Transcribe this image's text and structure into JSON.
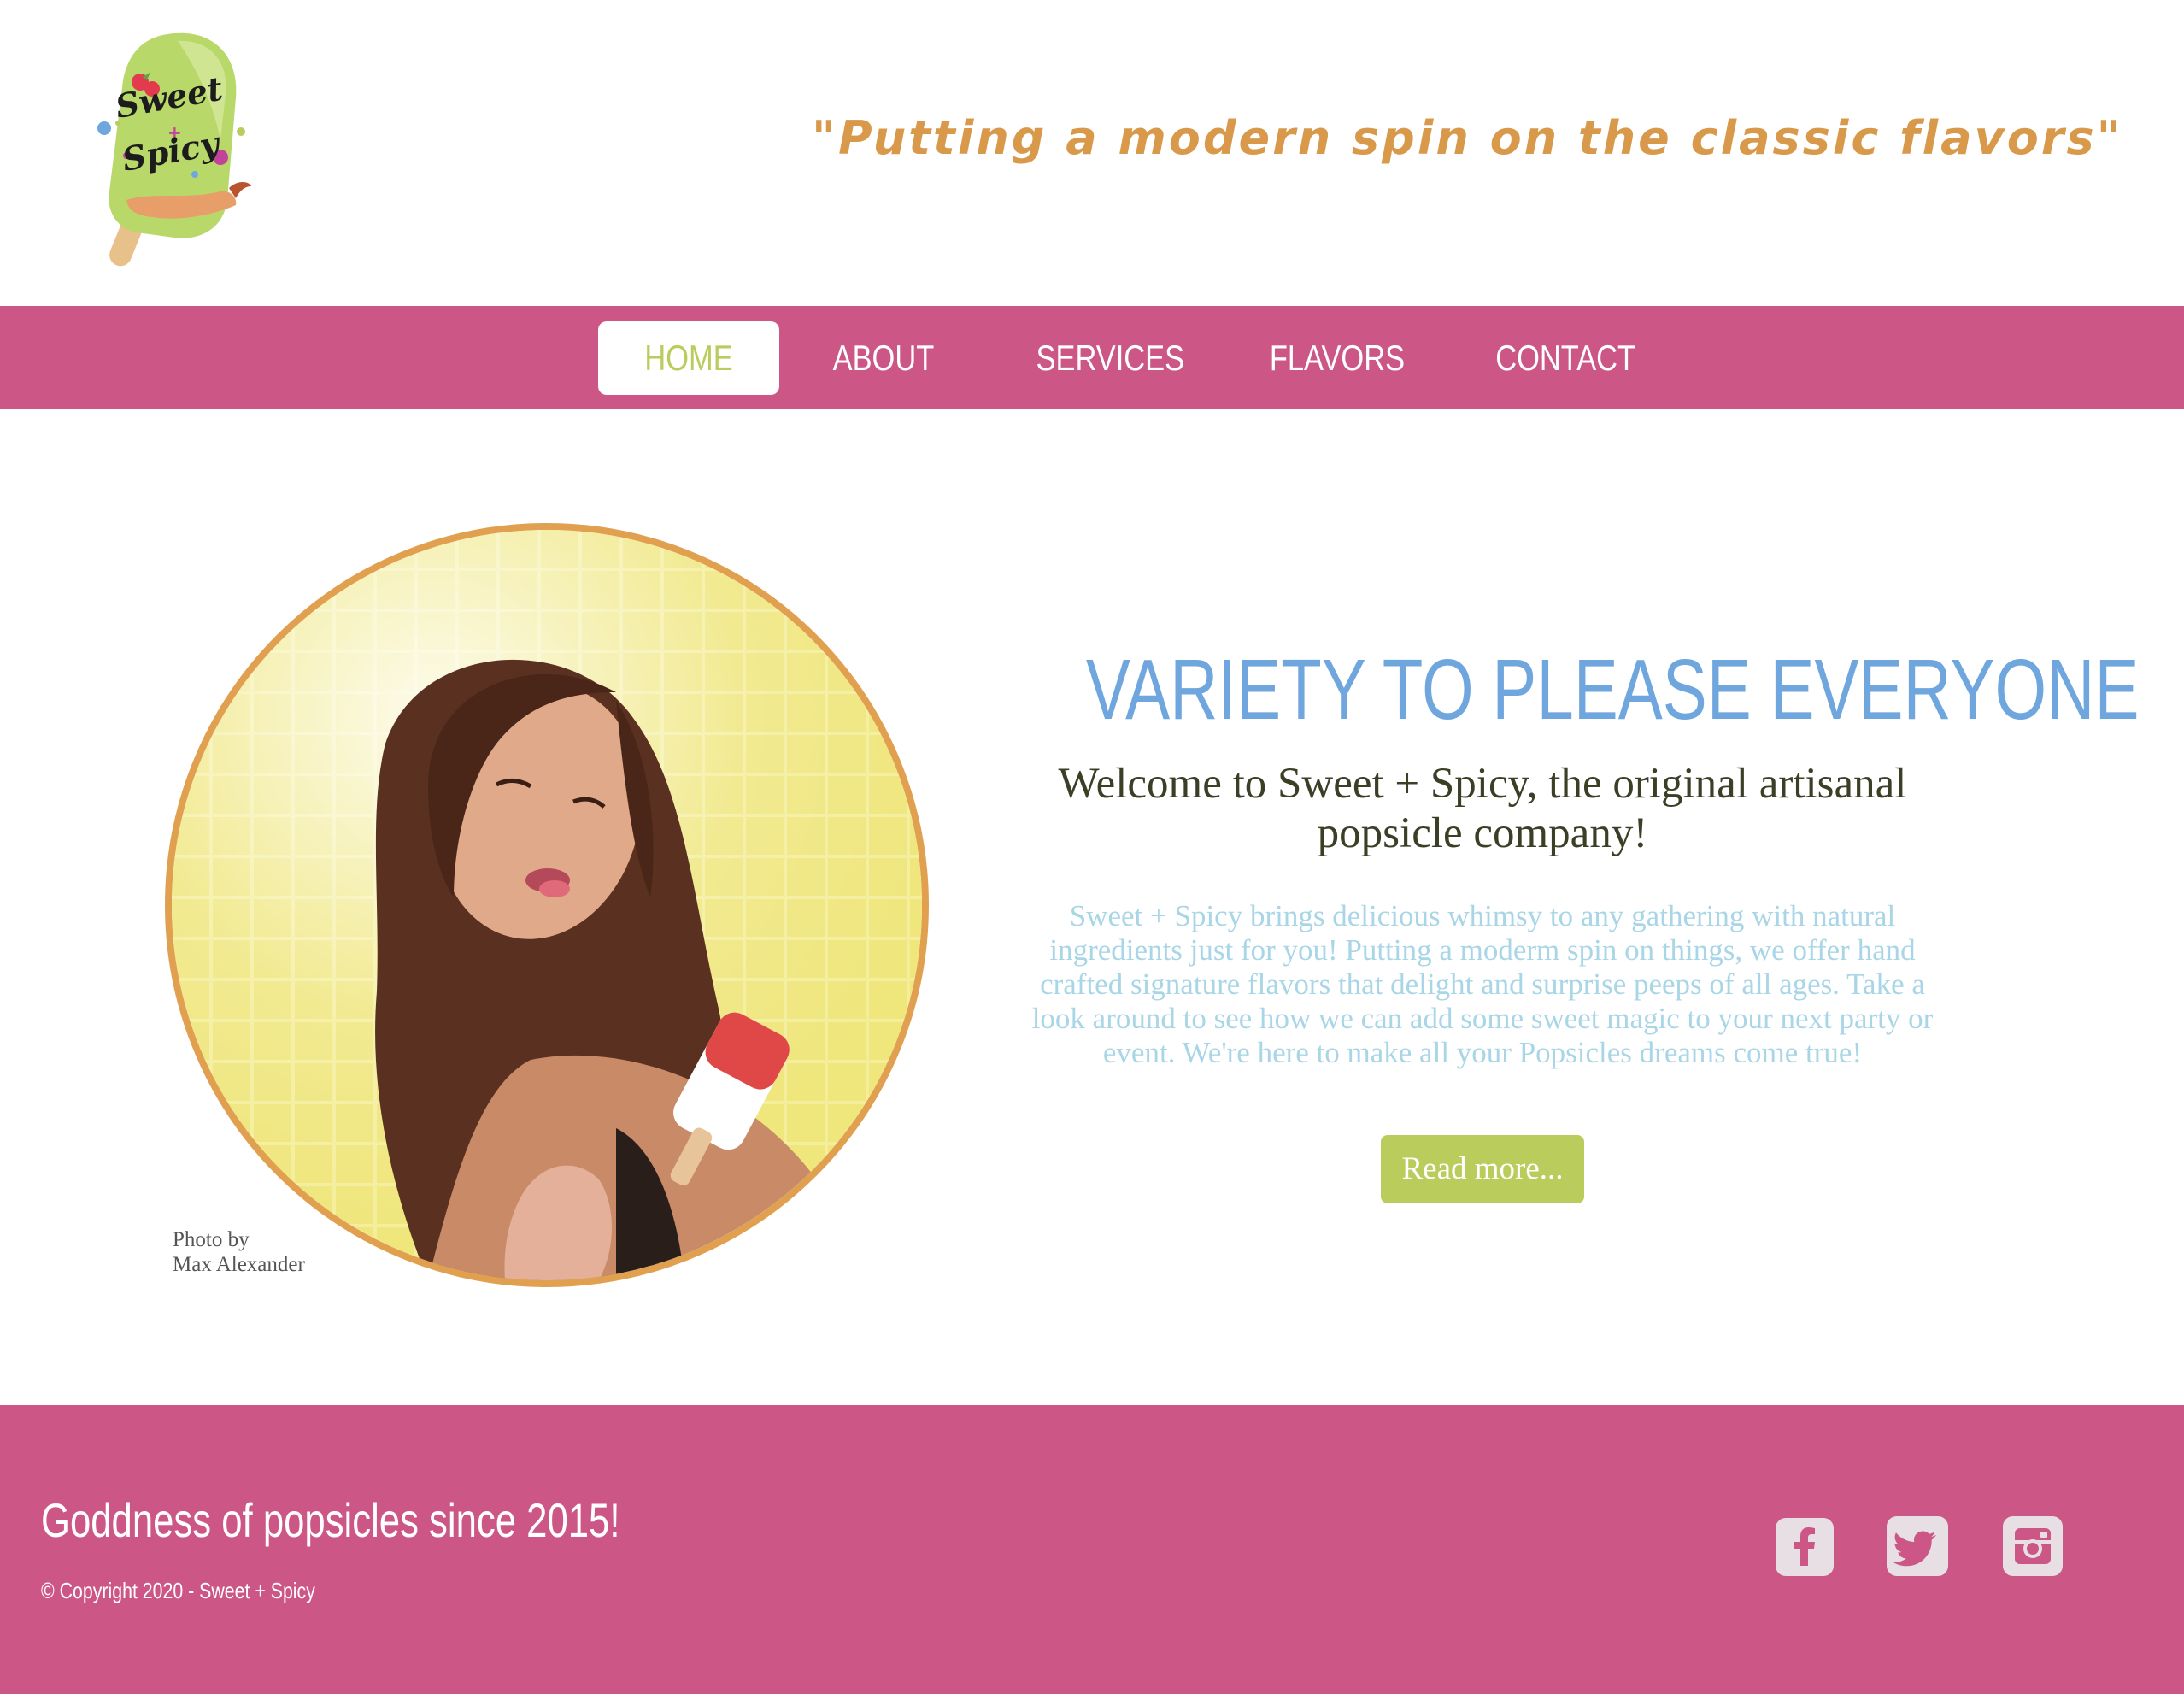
{
  "header": {
    "logo_text_1": "Sweet",
    "logo_text_2": "+",
    "logo_text_3": "Spicy",
    "tagline": "\"Putting a modern spin on the classic flavors\""
  },
  "nav": {
    "items": [
      {
        "label": "HOME",
        "active": true
      },
      {
        "label": "ABOUT",
        "active": false
      },
      {
        "label": "SERVICES",
        "active": false
      },
      {
        "label": "FLAVORS",
        "active": false
      },
      {
        "label": "CONTACT",
        "active": false
      }
    ]
  },
  "hero": {
    "photo_credit_line1": "Photo by",
    "photo_credit_line2": "Max Alexander",
    "title": "VARIETY TO PLEASE EVERYONE",
    "subtitle": "Welcome to Sweet + Spicy, the original artisanal popsicle company!",
    "body": "Sweet + Spicy brings delicious whimsy to any gathering with natural ingredients just for you! Putting a moderm spin on things, we offer hand crafted signature flavors that delight and surprise peeps of all ages. Take a look around to see how we can add some sweet magic to your next party or event. We're here to make all your Popsicles dreams come true!",
    "button_label": "Read more..."
  },
  "footer": {
    "headline": "Goddness of popsicles since 2015!",
    "copyright": "© Copyright 2020 - Sweet + Spicy",
    "social": [
      {
        "icon": "facebook-icon",
        "glyph": "f"
      },
      {
        "icon": "twitter-icon",
        "glyph": ""
      },
      {
        "icon": "instagram-icon",
        "glyph": ""
      }
    ]
  },
  "colors": {
    "brand_pink": "#cc5787",
    "accent_green": "#b9cc5c",
    "tagline_orange": "#d9994a",
    "title_blue": "#6ea6dd",
    "body_light_blue": "#a9d6e6",
    "photo_border": "#e0a050"
  }
}
